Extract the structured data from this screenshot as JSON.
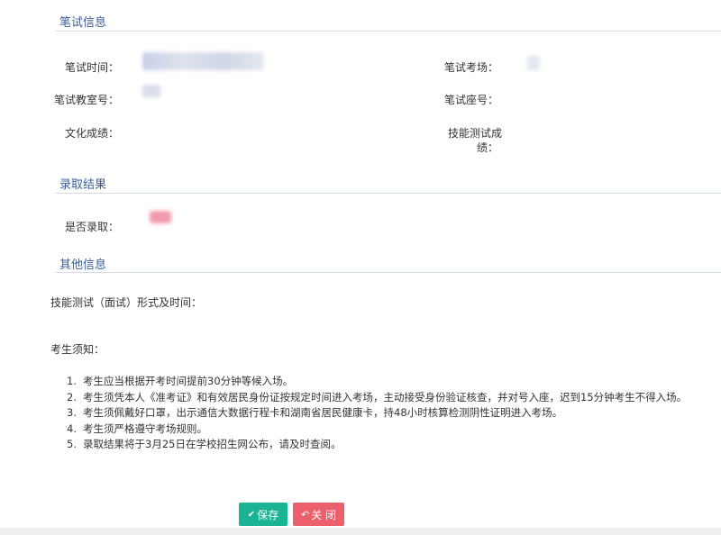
{
  "sections": {
    "exam_info": {
      "title": "笔试信息",
      "fields": {
        "exam_time": "笔试时间：",
        "exam_venue": "笔试考场：",
        "classroom_no": "笔试教室号：",
        "seat_no": "笔试座号：",
        "academic_score": "文化成绩：",
        "skill_score_line1": "技能测试成",
        "skill_score_line2": "绩："
      }
    },
    "admission": {
      "title": "录取结果",
      "admitted_label": "是否录取："
    },
    "other": {
      "title": "其他信息",
      "skill_test_label": "技能测试（面试）形式及时间：",
      "notice_label": "考生须知：",
      "notices": [
        {
          "num": "1.",
          "text": "考生应当根据开考时间提前30分钟等候入场。"
        },
        {
          "num": "2.",
          "text": "考生须凭本人《准考证》和有效居民身份证按规定时间进入考场，主动接受身份验证核查，并对号入座，迟到15分钟考生不得入场。"
        },
        {
          "num": "3.",
          "text": "考生须佩戴好口罩，出示通信大数据行程卡和湖南省居民健康卡，持48小时核算检测阴性证明进入考场。"
        },
        {
          "num": "4.",
          "text": "考生须严格遵守考场规则。"
        },
        {
          "num": "5.",
          "text": "录取结果将于3月25日在学校招生网公布，请及时查阅。"
        }
      ]
    }
  },
  "buttons": {
    "save_icon": "✔",
    "save_label": "保存",
    "close_icon": "↶",
    "close_label": "关 闭"
  },
  "colors": {
    "section_title": "#3b5e9b",
    "save_button": "#1ab394",
    "close_button": "#ec5f6c"
  }
}
